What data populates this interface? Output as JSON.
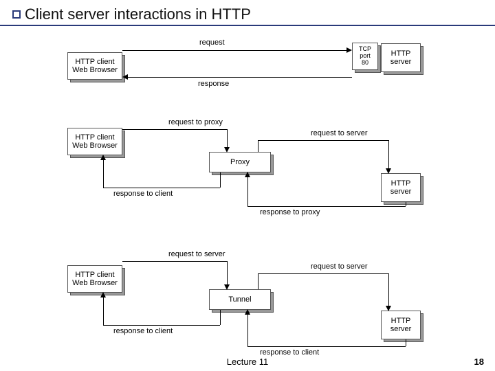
{
  "slide": {
    "title": "Client server interactions in HTTP",
    "lecture": "Lecture 11",
    "page": "18"
  },
  "diagram1": {
    "client": "HTTP client\nWeb Browser",
    "server_port": "TCP\nport\n80",
    "server": "HTTP\nserver",
    "request": "request",
    "response": "response"
  },
  "diagram2": {
    "client": "HTTP client\nWeb Browser",
    "proxy": "Proxy",
    "server": "HTTP\nserver",
    "req_to_proxy": "request to proxy",
    "req_to_server": "request to server",
    "resp_to_client": "response to client",
    "resp_to_proxy": "response to proxy"
  },
  "diagram3": {
    "client": "HTTP client\nWeb Browser",
    "tunnel": "Tunnel",
    "server": "HTTP\nserver",
    "req_to_server1": "request to server",
    "req_to_server2": "request to server",
    "resp_to_client1": "response to client",
    "resp_to_client2": "response to client"
  }
}
